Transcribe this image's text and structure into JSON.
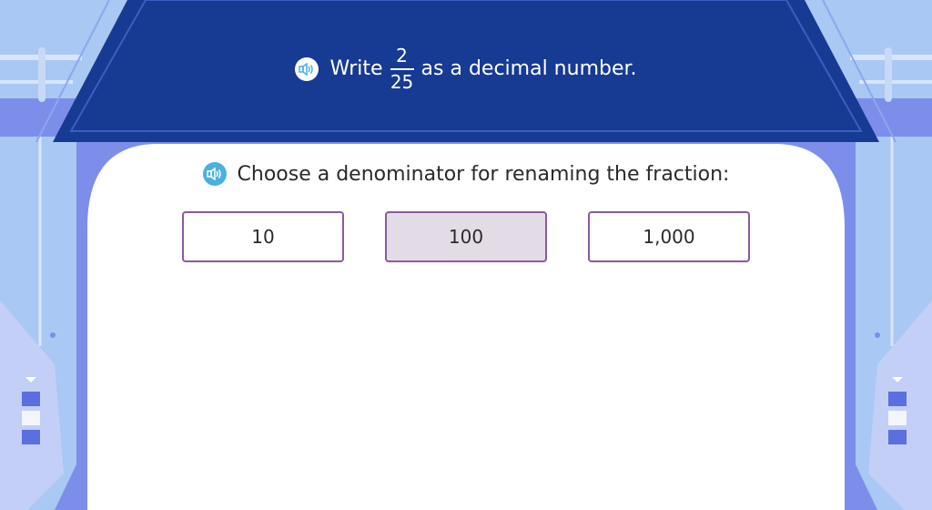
{
  "question": {
    "prefix": "Write",
    "numerator": "2",
    "denominator": "25",
    "suffix": "as a decimal number."
  },
  "prompt": {
    "text": "Choose a denominator for renaming the fraction:"
  },
  "choices": [
    {
      "label": "10",
      "selected": false
    },
    {
      "label": "100",
      "selected": true
    },
    {
      "label": "1,000",
      "selected": false
    }
  ],
  "icons": {
    "question_audio": "speaker-icon",
    "prompt_audio": "speaker-icon"
  },
  "colors": {
    "banner": "#173a93",
    "frame": "#7c8eea",
    "side_panel": "#a9c8f3",
    "choice_border": "#8a5a9c",
    "choice_selected": "#e3dbe6",
    "speaker_prompt": "#4bb0e0"
  }
}
